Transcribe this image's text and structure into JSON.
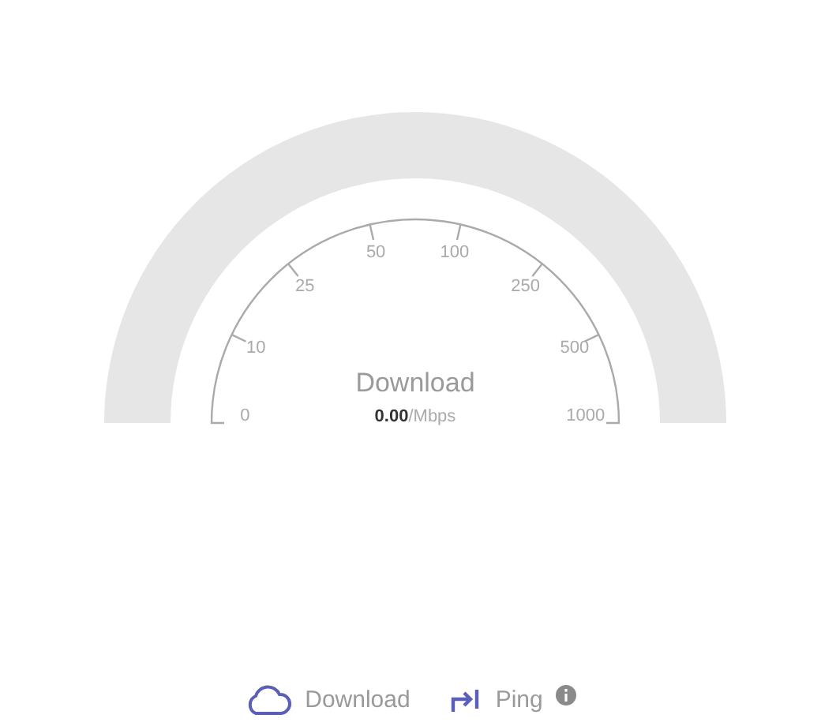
{
  "gauge": {
    "title": "Download",
    "value": "0.00",
    "unit": "/Mbps",
    "scale": [
      "0",
      "10",
      "25",
      "50",
      "100",
      "250",
      "500",
      "1000"
    ]
  },
  "legend": [
    {
      "label": "Download",
      "kind": "download"
    },
    {
      "label": "Ping",
      "kind": "ping"
    }
  ]
}
